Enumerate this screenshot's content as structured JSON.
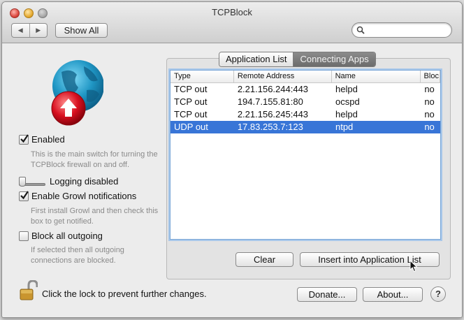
{
  "window": {
    "title": "TCPBlock"
  },
  "toolbar": {
    "back_glyph": "◀",
    "forward_glyph": "▶",
    "show_all_label": "Show All",
    "search_placeholder": "",
    "search_value": ""
  },
  "left": {
    "enabled": {
      "label": "Enabled",
      "checked": true,
      "hint": "This is the main switch for turning the TCPBlock firewall on and off."
    },
    "logging": {
      "label": "Logging disabled"
    },
    "growl": {
      "label": "Enable Growl notifications",
      "checked": true,
      "hint": "First install Growl and then check this box to get notified."
    },
    "block_outgoing": {
      "label": "Block all outgoing",
      "checked": false,
      "hint": "If selected then all outgoing connections are blocked."
    }
  },
  "tabs": [
    {
      "label": "Application List",
      "selected": false
    },
    {
      "label": "Connecting Apps",
      "selected": true
    }
  ],
  "table": {
    "columns": [
      "Type",
      "Remote Address",
      "Name",
      "Bloc"
    ],
    "rows": [
      {
        "type": "TCP out",
        "address": "2.21.156.244:443",
        "name": "helpd",
        "block": "no",
        "selected": false
      },
      {
        "type": "TCP out",
        "address": "194.7.155.81:80",
        "name": "ocspd",
        "block": "no",
        "selected": false
      },
      {
        "type": "TCP out",
        "address": "2.21.156.245:443",
        "name": "helpd",
        "block": "no",
        "selected": false
      },
      {
        "type": "UDP out",
        "address": "17.83.253.7:123",
        "name": "ntpd",
        "block": "no",
        "selected": true
      }
    ]
  },
  "buttons": {
    "clear": "Clear",
    "insert": "Insert into Application List",
    "donate": "Donate...",
    "about": "About...",
    "help": "?"
  },
  "footer": {
    "lock_text": "Click the lock to prevent further changes."
  },
  "colors": {
    "selection": "#3875d7",
    "tab_selected": "#6c6c6c",
    "globe": "#2a9fc9",
    "badge": "#d81020"
  },
  "icons": [
    "search-icon",
    "globe-icon",
    "upload-badge-icon",
    "lock-icon",
    "checkmark-icon",
    "pointer-cursor-icon"
  ]
}
